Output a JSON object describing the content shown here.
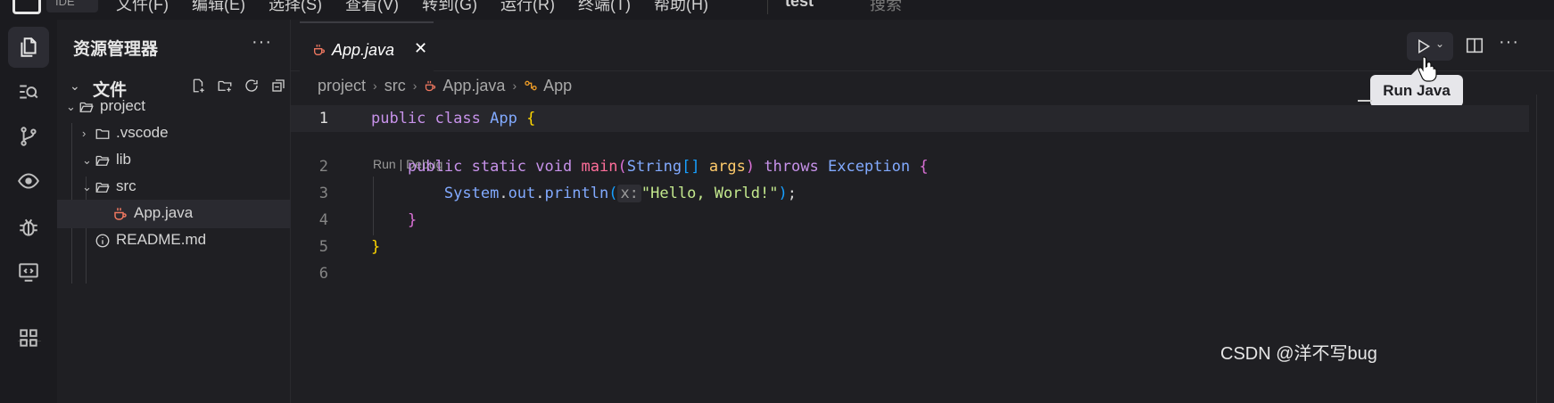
{
  "menubar": {
    "ide_label": "IDE",
    "items": [
      "文件(F)",
      "编辑(E)",
      "选择(S)",
      "查看(V)",
      "转到(G)",
      "运行(R)",
      "终端(T)",
      "帮助(H)"
    ],
    "project": "test",
    "search_placeholder": "搜索"
  },
  "explorer": {
    "title": "资源管理器",
    "more": "···",
    "section_label": "文件",
    "tree": [
      {
        "name": "project",
        "type": "folder",
        "expanded": true
      },
      {
        "name": ".vscode",
        "type": "folder",
        "expanded": false
      },
      {
        "name": "lib",
        "type": "folder",
        "expanded": true
      },
      {
        "name": "src",
        "type": "folder",
        "expanded": true
      },
      {
        "name": "App.java",
        "type": "java-file",
        "selected": true
      },
      {
        "name": "README.md",
        "type": "info-file"
      }
    ]
  },
  "editor": {
    "tab": {
      "name": "App.java",
      "close": "✕"
    },
    "tooltip": "Run Java",
    "more": "···",
    "breadcrumb": [
      "project",
      "src",
      "App.java",
      "App"
    ],
    "codelens": "Run | Debug",
    "line_numbers": [
      "1",
      "2",
      "3",
      "4",
      "5",
      "6"
    ],
    "code": {
      "line1": {
        "kw1": "public",
        "kw2": "class",
        "cls": "App",
        "brace": "{"
      },
      "line2": {
        "kw1": "public",
        "kw2": "static",
        "kw3": "void",
        "fn": "main",
        "po": "(",
        "type": "String",
        "arr": "[]",
        "param": "args",
        "pc": ")",
        "kw4": "throws",
        "exc": "Exception",
        "brace": "{"
      },
      "line3": {
        "obj": "System",
        "dot1": ".",
        "field": "out",
        "dot2": ".",
        "method": "println",
        "po": "(",
        "hint": "x:",
        "str": "\"Hello, World!\"",
        "pc": ")",
        "semi": ";"
      },
      "line4": {
        "brace": "}"
      },
      "line5": {
        "brace": "}"
      }
    }
  },
  "watermark": "CSDN @洋不写bug",
  "colors": {
    "keyword": "#c792ea",
    "class": "#82aaff",
    "function": "#ff6e9a",
    "param": "#ffcb6b",
    "string": "#c3e88d",
    "java_icon": "#f07860"
  }
}
